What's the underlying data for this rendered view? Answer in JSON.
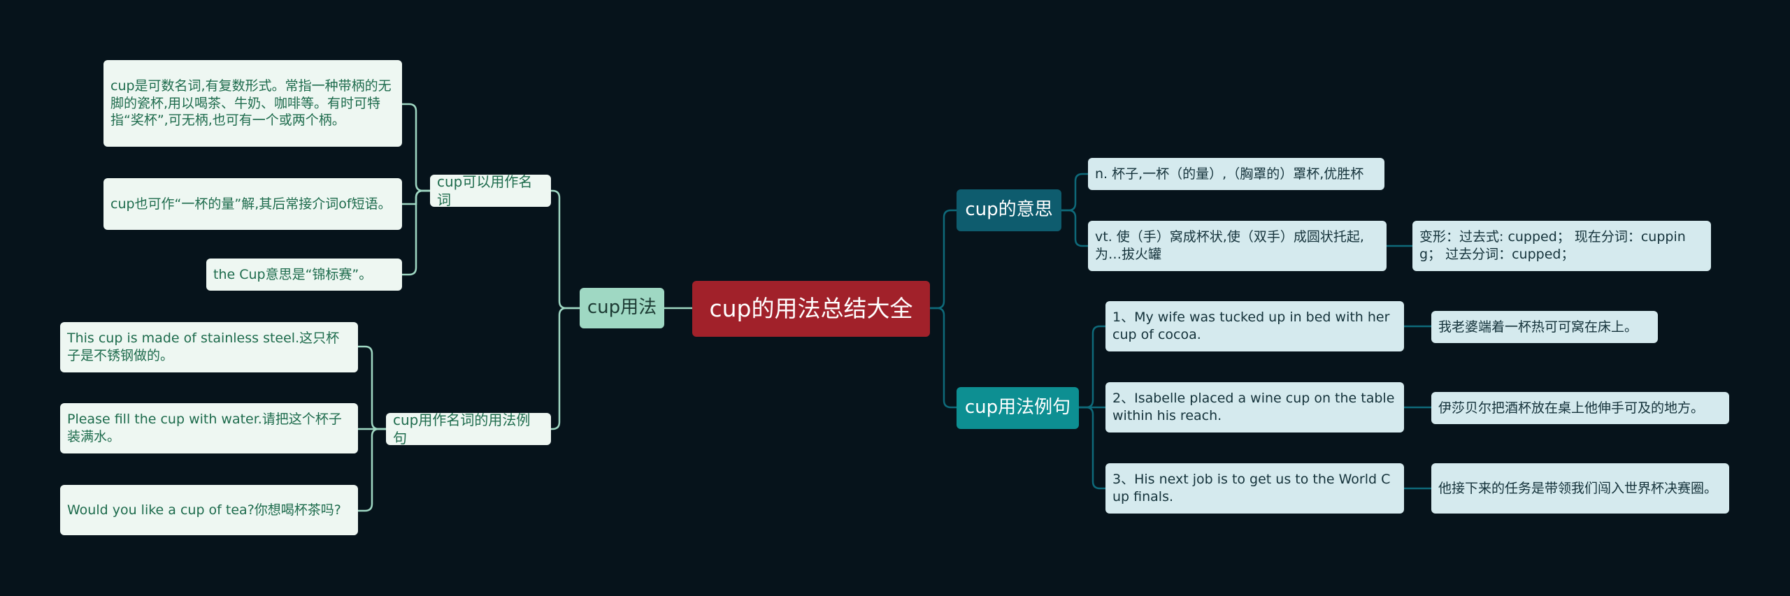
{
  "mindmap": {
    "root": "cup的用法总结大全",
    "left": {
      "branch": "cup用法",
      "noun_group": {
        "label": "cup可以用作名词",
        "items": [
          "cup是可数名词,有复数形式。常指一种带柄的无脚的瓷杯,用以喝茶、牛奶、咖啡等。有时可特指“奖杯”,可无柄,也可有一个或两个柄。",
          "cup也可作“一杯的量”解,其后常接介词of短语。",
          "the Cup意思是“锦标赛”。"
        ]
      },
      "example_group": {
        "label": "cup用作名词的用法例句",
        "items": [
          "This cup is made of stainless steel.这只杯子是不锈钢做的。",
          "Please fill the cup with water.请把这个杯子装满水。",
          "Would you like a cup of tea?你想喝杯茶吗?"
        ]
      }
    },
    "right": {
      "meaning": {
        "label": "cup的意思",
        "noun": "n. 杯子,一杯（的量）,（胸罩的）罩杯,优胜杯",
        "verb": "vt. 使（手）窝成杯状,使（双手）成圆状托起,为…拔火罐",
        "forms": "变形：过去式: cupped；  现在分词：cupping；  过去分词：cupped；"
      },
      "examples": {
        "label": "cup用法例句",
        "items": [
          {
            "en": "1、My wife was tucked up in bed with her cup of cocoa.",
            "zh": "我老婆端着一杯热可可窝在床上。"
          },
          {
            "en": "2、Isabelle placed a wine cup on the table within his reach.",
            "zh": "伊莎贝尔把酒杯放在桌上他伸手可及的地方。"
          },
          {
            "en": "3、His next job is to get us to the World Cup finals.",
            "zh": "他接下来的任务是带领我们闯入世界杯决赛圈。"
          }
        ]
      }
    },
    "colors": {
      "background": "#06131b",
      "root": "#a1212a",
      "left_branch": "#9fd8c3",
      "meaning_branch": "#0e5c6e",
      "examples_branch": "#0d8f92",
      "left_line": "#9fd8c3",
      "right_line": "#0e6a7a"
    }
  }
}
